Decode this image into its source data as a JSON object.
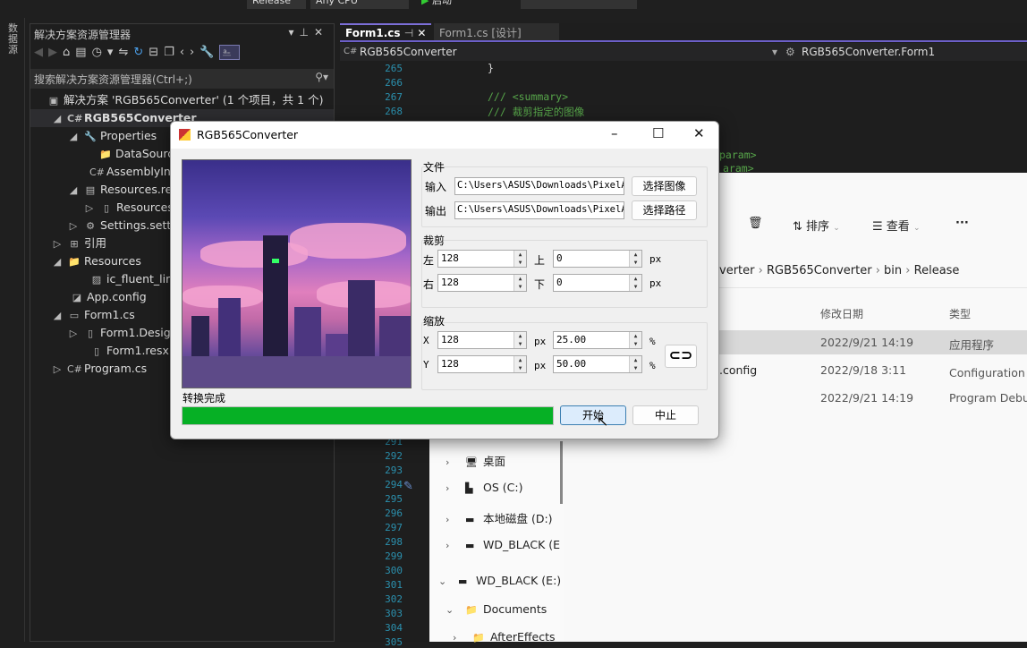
{
  "toolbar": {
    "config": "Release",
    "platform": "Any CPU",
    "start_label": "启动"
  },
  "left_strip": {
    "label": "数据源"
  },
  "solution_explorer": {
    "title": "解决方案资源管理器",
    "search_placeholder": "搜索解决方案资源管理器(Ctrl+;)",
    "items": [
      {
        "label": "解决方案 'RGB565Converter' (1 个项目，共 1 个)",
        "icon": "solution-icon"
      },
      {
        "label": "RGB565Converter",
        "icon": "csharp-project-icon"
      },
      {
        "label": "Properties",
        "icon": "wrench-icon"
      },
      {
        "label": "DataSources",
        "icon": "folder-icon"
      },
      {
        "label": "AssemblyInfo.cs",
        "icon": "csharp-file-icon"
      },
      {
        "label": "Resources.resx",
        "icon": "resx-icon"
      },
      {
        "label": "Resources.Designer.cs",
        "icon": "file-icon"
      },
      {
        "label": "Settings.settings",
        "icon": "gear-icon"
      },
      {
        "label": "引用",
        "icon": "references-icon"
      },
      {
        "label": "Resources",
        "icon": "folder-icon"
      },
      {
        "label": "ic_fluent_link",
        "icon": "image-icon"
      },
      {
        "label": "App.config",
        "icon": "config-icon"
      },
      {
        "label": "Form1.cs",
        "icon": "form-icon"
      },
      {
        "label": "Form1.Designer.cs",
        "icon": "file-icon"
      },
      {
        "label": "Form1.resx",
        "icon": "file-icon"
      },
      {
        "label": "Program.cs",
        "icon": "csharp-file-icon"
      }
    ]
  },
  "editor": {
    "tabs": [
      {
        "label": "Form1.cs",
        "active": true
      },
      {
        "label": "Form1.cs [设计]",
        "active": false
      }
    ],
    "nav_left": "RGB565Converter",
    "nav_right": "RGB565Converter.Form1",
    "lines_top": [
      {
        "n": "265",
        "code": "}"
      },
      {
        "n": "266",
        "code": ""
      },
      {
        "n": "267",
        "code": "/// <summary>"
      },
      {
        "n": "268",
        "code": "/// 裁剪指定的图像"
      }
    ],
    "fragments": [
      "param>",
      "aram>"
    ],
    "lines_bottom": [
      "291",
      "292",
      "293",
      "294",
      "295",
      "296",
      "297",
      "298",
      "299",
      "300",
      "301",
      "302",
      "303",
      "304",
      "305"
    ]
  },
  "explorer": {
    "toolbar": {
      "sort": "排序",
      "view": "查看",
      "more": "···"
    },
    "breadcrumb": [
      "verter",
      "RGB565Converter",
      "bin",
      "Release"
    ],
    "columns": {
      "date": "修改日期",
      "type": "类型"
    },
    "files": [
      {
        "name": "",
        "date": "2022/9/21 14:19",
        "type": "应用程序",
        "selected": true
      },
      {
        "name": ".config",
        "date": "2022/9/18 3:11",
        "type": "Configuration 源"
      },
      {
        "name": "",
        "date": "2022/9/21 14:19",
        "type": "Program Debu"
      }
    ],
    "nav": [
      {
        "label": "桌面",
        "chev": "›"
      },
      {
        "label": "OS (C:)",
        "chev": "›"
      },
      {
        "label": "本地磁盘 (D:)",
        "chev": "›"
      },
      {
        "label": "WD_BLACK (E",
        "chev": "›"
      },
      {
        "label": "WD_BLACK (E:)",
        "chev": "⌄"
      },
      {
        "label": "Documents",
        "chev": "⌄"
      },
      {
        "label": "AfterEffects",
        "chev": "›"
      }
    ]
  },
  "dialog": {
    "title": "RGB565Converter",
    "file_group": {
      "title": "文件",
      "input_label": "输入",
      "input_value": "C:\\Users\\ASUS\\Downloads\\PixelAr",
      "input_button": "选择图像",
      "output_label": "输出",
      "output_value": "C:\\Users\\ASUS\\Downloads\\PixelAr",
      "output_button": "选择路径"
    },
    "crop_group": {
      "title": "裁剪",
      "left_label": "左",
      "left": "128",
      "top_label": "上",
      "top": "0",
      "right_label": "右",
      "right": "128",
      "bottom_label": "下",
      "bottom": "0",
      "unit": "px"
    },
    "scale_group": {
      "title": "缩放",
      "x_label": "X",
      "x": "128",
      "x_unit": "px",
      "x_pct": "25.00",
      "y_label": "Y",
      "y": "128",
      "y_unit": "px",
      "y_pct": "50.00",
      "pct_unit": "%"
    },
    "status": "转换完成",
    "progress": 100,
    "start_button": "开始",
    "stop_button": "中止",
    "progress_color": "#06b025"
  }
}
